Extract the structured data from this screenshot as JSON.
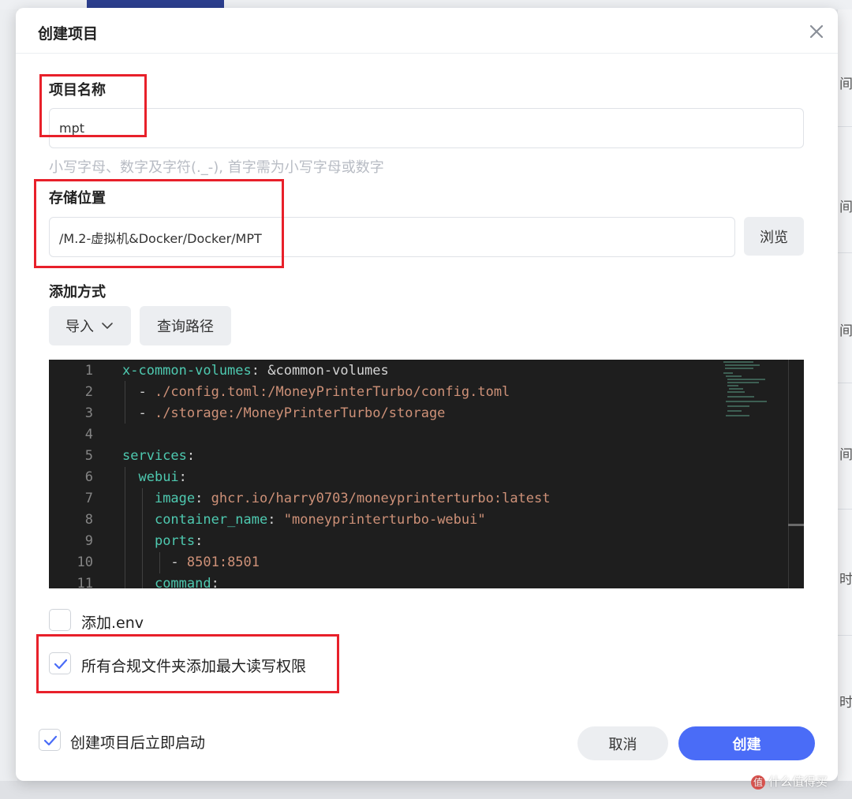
{
  "dialog": {
    "title": "创建项目"
  },
  "form": {
    "name_label": "项目名称",
    "name_value": "mpt",
    "name_hint": "小写字母、数字及字符(._-), 首字需为小写字母或数字",
    "location_label": "存储位置",
    "location_value": "/M.2-虚拟机&Docker/Docker/MPT",
    "browse_label": "浏览",
    "method_label": "添加方式",
    "import_label": "导入",
    "query_path_label": "查询路径"
  },
  "editor": {
    "line_numbers": [
      "1",
      "2",
      "3",
      "4",
      "5",
      "6",
      "7",
      "8",
      "9",
      "10",
      "11"
    ],
    "lines": [
      [
        {
          "t": "x-common-volumes",
          "c": "k"
        },
        {
          "t": ": &common-volumes",
          "c": "p"
        }
      ],
      [
        {
          "t": "  - ",
          "c": "p"
        },
        {
          "t": "./config.toml:/MoneyPrinterTurbo/config.toml",
          "c": "s"
        }
      ],
      [
        {
          "t": "  - ",
          "c": "p"
        },
        {
          "t": "./storage:/MoneyPrinterTurbo/storage",
          "c": "s"
        }
      ],
      [],
      [
        {
          "t": "services",
          "c": "k"
        },
        {
          "t": ":",
          "c": "p"
        }
      ],
      [
        {
          "t": "  ",
          "c": "p"
        },
        {
          "t": "webui",
          "c": "k"
        },
        {
          "t": ":",
          "c": "p"
        }
      ],
      [
        {
          "t": "    ",
          "c": "p"
        },
        {
          "t": "image",
          "c": "k"
        },
        {
          "t": ": ",
          "c": "p"
        },
        {
          "t": "ghcr.io/harry0703/moneyprinterturbo:latest",
          "c": "s"
        }
      ],
      [
        {
          "t": "    ",
          "c": "p"
        },
        {
          "t": "container_name",
          "c": "k"
        },
        {
          "t": ": ",
          "c": "p"
        },
        {
          "t": "\"moneyprinterturbo-webui\"",
          "c": "s"
        }
      ],
      [
        {
          "t": "    ",
          "c": "p"
        },
        {
          "t": "ports",
          "c": "k"
        },
        {
          "t": ":",
          "c": "p"
        }
      ],
      [
        {
          "t": "      - ",
          "c": "p"
        },
        {
          "t": "8501:8501",
          "c": "s"
        }
      ],
      [
        {
          "t": "    ",
          "c": "p"
        },
        {
          "t": "command",
          "c": "k"
        },
        {
          "t": ":",
          "c": "p"
        }
      ]
    ]
  },
  "options": {
    "add_env_label": "添加.env",
    "add_env_checked": false,
    "max_perm_label": "所有合规文件夹添加最大读写权限",
    "max_perm_checked": true,
    "auto_start_label": "创建项目后立即启动",
    "auto_start_checked": true
  },
  "footer": {
    "cancel_label": "取消",
    "create_label": "创建"
  },
  "background": {
    "fragments": [
      "间",
      "间",
      "间",
      "间",
      "时",
      "时"
    ],
    "watermark": "什么值得买",
    "watermark_icon": "值"
  },
  "colors": {
    "primary": "#4a6cf7",
    "annotation": "#e8202a",
    "check": "#4a6cf7",
    "editor_bg": "#1e1e1e"
  }
}
